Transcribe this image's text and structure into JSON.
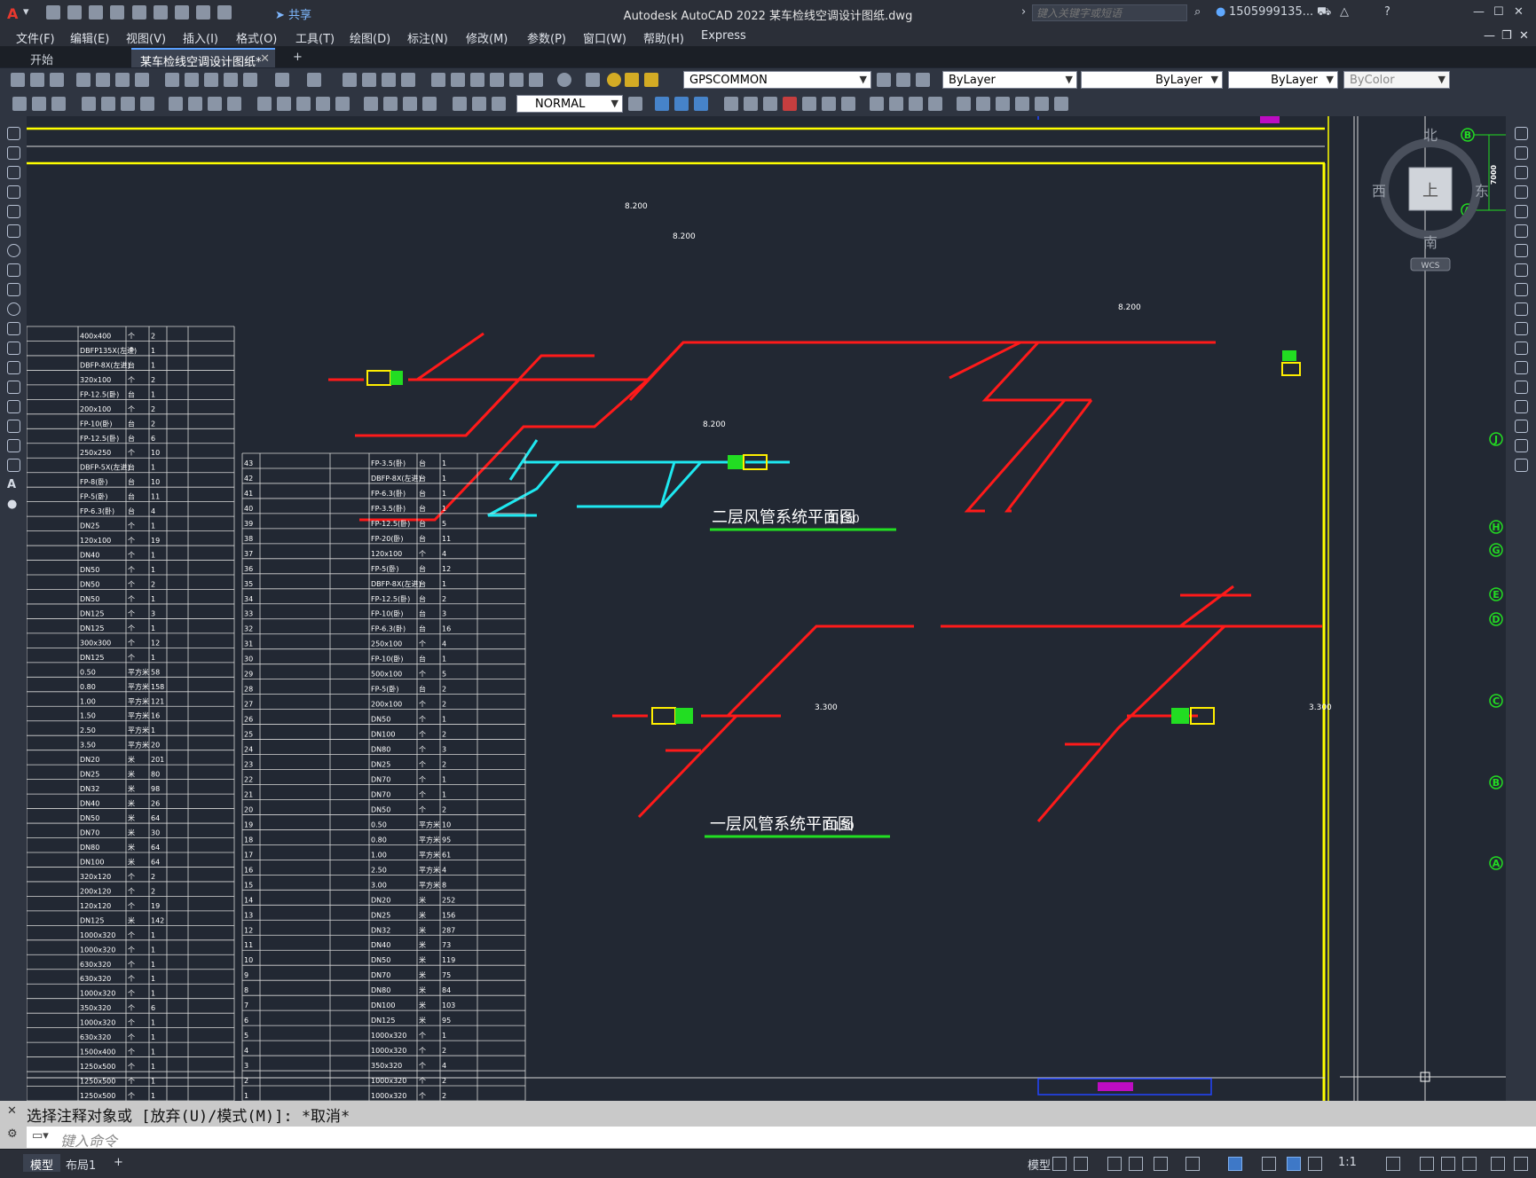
{
  "title_bar": {
    "title": "Autodesk AutoCAD 2022    某车检线空调设计图纸.dwg",
    "share_label": "共享",
    "search_placeholder": "键入关键字或短语",
    "user": "1505999135...",
    "window_controls": [
      "—",
      "☐",
      "✕"
    ]
  },
  "menu": [
    "文件(F)",
    "编辑(E)",
    "视图(V)",
    "插入(I)",
    "格式(O)",
    "工具(T)",
    "绘图(D)",
    "标注(N)",
    "修改(M)",
    "参数(P)",
    "窗口(W)",
    "帮助(H)",
    "Express"
  ],
  "tabs": [
    {
      "label": "开始",
      "active": false
    },
    {
      "label": "某车检线空调设计图纸*",
      "active": true
    }
  ],
  "toolbar": {
    "layer": "GPSCOMMON",
    "color": "ByLayer",
    "linetype": "ByLayer",
    "lineweight": "ByLayer",
    "plotstyle": "ByColor",
    "dim_style": "NORMAL"
  },
  "drawing": {
    "title_upper": "二层风管系统平面图",
    "scale_upper": "1:150",
    "title_lower": "一层风管系统平面图",
    "scale_lower": "1:150",
    "level_labels": [
      "8.200",
      "8.200",
      "8.200",
      "8.200",
      "3.300",
      "3.300"
    ],
    "grid_bubbles": [
      "J",
      "H",
      "G",
      "E",
      "D",
      "C",
      "B",
      "A"
    ],
    "top_bubbles": [
      "B",
      "A"
    ],
    "top_dim": "7000"
  },
  "viewcube": {
    "north": "北",
    "south": "南",
    "east": "东",
    "west": "西",
    "top": "上",
    "wcs": "WCS"
  },
  "schedule_left": [
    [
      "400x400",
      "个",
      "2"
    ],
    [
      "DBFP135X(左进)",
      "个",
      "1"
    ],
    [
      "DBFP-8X(左进)",
      "台",
      "1"
    ],
    [
      "320x100",
      "个",
      "2"
    ],
    [
      "FP-12.5(卧)",
      "台",
      "1"
    ],
    [
      "200x100",
      "个",
      "2"
    ],
    [
      "FP-10(卧)",
      "台",
      "2"
    ],
    [
      "FP-12.5(卧)",
      "台",
      "6"
    ],
    [
      "250x250",
      "个",
      "10"
    ],
    [
      "DBFP-5X(左进)",
      "台",
      "1"
    ],
    [
      "FP-8(卧)",
      "台",
      "10"
    ],
    [
      "FP-5(卧)",
      "台",
      "11"
    ],
    [
      "FP-6.3(卧)",
      "台",
      "4"
    ],
    [
      "DN25",
      "个",
      "1"
    ],
    [
      "120x100",
      "个",
      "19"
    ],
    [
      "DN40",
      "个",
      "1"
    ],
    [
      "DN50",
      "个",
      "1"
    ],
    [
      "DN50",
      "个",
      "2"
    ],
    [
      "DN50",
      "个",
      "1"
    ],
    [
      "DN125",
      "个",
      "3"
    ],
    [
      "DN125",
      "个",
      "1"
    ],
    [
      "300x300",
      "个",
      "12"
    ],
    [
      "DN125",
      "个",
      "1"
    ],
    [
      "0.50",
      "平方米",
      "58"
    ],
    [
      "0.80",
      "平方米",
      "158"
    ],
    [
      "1.00",
      "平方米",
      "121"
    ],
    [
      "1.50",
      "平方米",
      "16"
    ],
    [
      "2.50",
      "平方米",
      "1"
    ],
    [
      "3.50",
      "平方米",
      "20"
    ],
    [
      "DN20",
      "米",
      "201"
    ],
    [
      "DN25",
      "米",
      "80"
    ],
    [
      "DN32",
      "米",
      "98"
    ],
    [
      "DN40",
      "米",
      "26"
    ],
    [
      "DN50",
      "米",
      "64"
    ],
    [
      "DN70",
      "米",
      "30"
    ],
    [
      "DN80",
      "米",
      "64"
    ],
    [
      "DN100",
      "米",
      "64"
    ],
    [
      "320x120",
      "个",
      "2"
    ],
    [
      "200x120",
      "个",
      "2"
    ],
    [
      "120x120",
      "个",
      "19"
    ],
    [
      "DN125",
      "米",
      "142"
    ],
    [
      "1000x320",
      "个",
      "1"
    ],
    [
      "1000x320",
      "个",
      "1"
    ],
    [
      "630x320",
      "个",
      "1"
    ],
    [
      "630x320",
      "个",
      "1"
    ],
    [
      "1000x320",
      "个",
      "1"
    ],
    [
      "350x320",
      "个",
      "6"
    ],
    [
      "1000x320",
      "个",
      "1"
    ],
    [
      "630x320",
      "个",
      "1"
    ],
    [
      "1500x400",
      "个",
      "1"
    ],
    [
      "1250x500",
      "个",
      "1"
    ],
    [
      "1250x500",
      "个",
      "1"
    ],
    [
      "1250x500",
      "个",
      "1"
    ]
  ],
  "schedule_right": [
    [
      "43",
      "FP-3.5(卧)",
      "台",
      "1"
    ],
    [
      "42",
      "DBFP-8X(左进)",
      "台",
      "1"
    ],
    [
      "41",
      "FP-6.3(卧)",
      "台",
      "1"
    ],
    [
      "40",
      "FP-3.5(卧)",
      "台",
      "1"
    ],
    [
      "39",
      "FP-12.5(卧)",
      "台",
      "5"
    ],
    [
      "38",
      "FP-20(卧)",
      "台",
      "11"
    ],
    [
      "37",
      "120x100",
      "个",
      "4"
    ],
    [
      "36",
      "FP-5(卧)",
      "台",
      "12"
    ],
    [
      "35",
      "DBFP-8X(左进)",
      "台",
      "1"
    ],
    [
      "34",
      "FP-12.5(卧)",
      "台",
      "2"
    ],
    [
      "33",
      "FP-10(卧)",
      "台",
      "3"
    ],
    [
      "32",
      "FP-6.3(卧)",
      "台",
      "16"
    ],
    [
      "31",
      "250x100",
      "个",
      "4"
    ],
    [
      "30",
      "FP-10(卧)",
      "台",
      "1"
    ],
    [
      "29",
      "500x100",
      "个",
      "5"
    ],
    [
      "28",
      "FP-5(卧)",
      "台",
      "2"
    ],
    [
      "27",
      "200x100",
      "个",
      "2"
    ],
    [
      "26",
      "DN50",
      "个",
      "1"
    ],
    [
      "25",
      "DN100",
      "个",
      "2"
    ],
    [
      "24",
      "DN80",
      "个",
      "3"
    ],
    [
      "23",
      "DN25",
      "个",
      "2"
    ],
    [
      "22",
      "DN70",
      "个",
      "1"
    ],
    [
      "21",
      "DN70",
      "个",
      "1"
    ],
    [
      "20",
      "DN50",
      "个",
      "2"
    ],
    [
      "19",
      "0.50",
      "平方米",
      "10"
    ],
    [
      "18",
      "0.80",
      "平方米",
      "95"
    ],
    [
      "17",
      "1.00",
      "平方米",
      "61"
    ],
    [
      "16",
      "2.50",
      "平方米",
      "4"
    ],
    [
      "15",
      "3.00",
      "平方米",
      "8"
    ],
    [
      "14",
      "DN20",
      "米",
      "252"
    ],
    [
      "13",
      "DN25",
      "米",
      "156"
    ],
    [
      "12",
      "DN32",
      "米",
      "287"
    ],
    [
      "11",
      "DN40",
      "米",
      "73"
    ],
    [
      "10",
      "DN50",
      "米",
      "119"
    ],
    [
      "9",
      "DN70",
      "米",
      "75"
    ],
    [
      "8",
      "DN80",
      "米",
      "84"
    ],
    [
      "7",
      "DN100",
      "米",
      "103"
    ],
    [
      "6",
      "DN125",
      "米",
      "95"
    ],
    [
      "5",
      "1000x320",
      "个",
      "1"
    ],
    [
      "4",
      "1000x320",
      "个",
      "2"
    ],
    [
      "3",
      "350x320",
      "个",
      "4"
    ],
    [
      "2",
      "1000x320",
      "个",
      "2"
    ],
    [
      "1",
      "1000x320",
      "个",
      "2"
    ]
  ],
  "command": {
    "history": "选择注释对象或 [放弃(U)/模式(M)]: *取消*",
    "placeholder": "键入命令"
  },
  "status": {
    "layout_tabs": [
      "模型",
      "布局1"
    ],
    "model_label": "模型",
    "scale": "1:1"
  },
  "colors": {
    "duct_red": "#ff1a1a",
    "duct_cyan": "#1ee8f0",
    "frame_yellow": "#ffff00",
    "title_green": "#22e022",
    "bubble_green": "#22dd22"
  }
}
